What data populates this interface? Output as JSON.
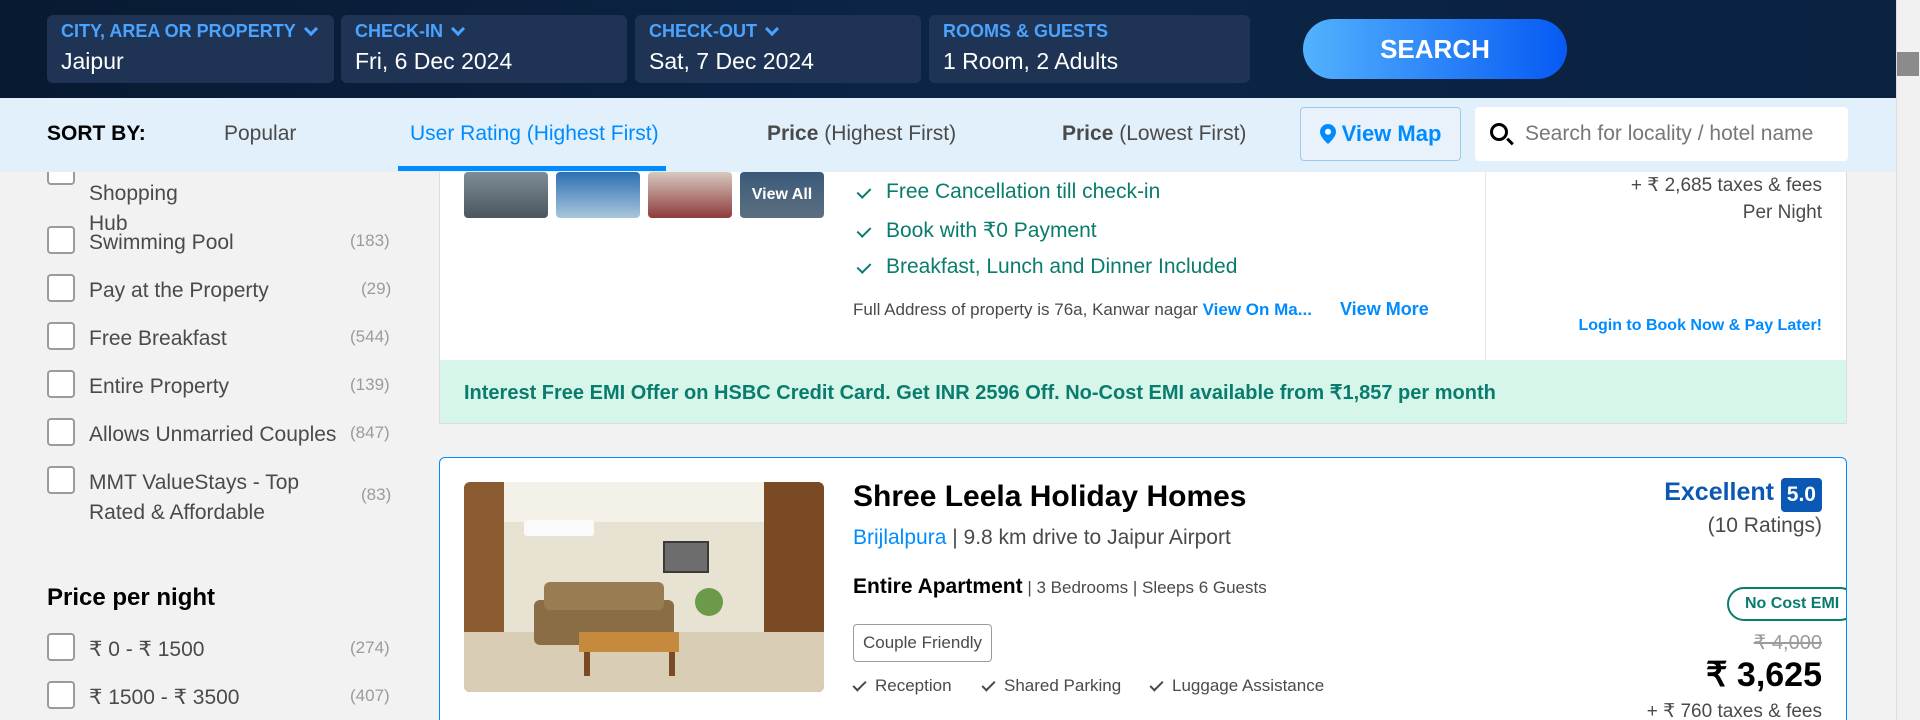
{
  "search": {
    "city_label": "CITY, AREA OR PROPERTY",
    "city_value": "Jaipur",
    "checkin_label": "CHECK-IN",
    "checkin_value": "Fri, 6 Dec 2024",
    "checkout_label": "CHECK-OUT",
    "checkout_value": "Sat, 7 Dec 2024",
    "rooms_label": "ROOMS & GUESTS",
    "rooms_value": "1 Room, 2 Adults",
    "button": "SEARCH"
  },
  "sort": {
    "label": "SORT BY:",
    "options": [
      {
        "main": "Popular",
        "sub": ""
      },
      {
        "main": "User Rating",
        "sub": "(Highest First)"
      },
      {
        "main": "Price",
        "sub": "(Highest First)"
      },
      {
        "main": "Price",
        "sub": "(Lowest First)"
      }
    ],
    "view_map": "View Map",
    "search_placeholder": "Search for locality / hotel name"
  },
  "filters": {
    "items": [
      {
        "label": "Shopping Hub",
        "count": ""
      },
      {
        "label": "Swimming Pool",
        "count": "(183)"
      },
      {
        "label": "Pay at the Property",
        "count": "(29)"
      },
      {
        "label": "Free Breakfast",
        "count": "(544)"
      },
      {
        "label": "Entire Property",
        "count": "(139)"
      },
      {
        "label": "Allows Unmarried Couples",
        "count": "(847)"
      },
      {
        "label": "MMT ValueStays - Top Rated & Affordable",
        "count": "(83)"
      }
    ],
    "price_heading": "Price per night",
    "price_items": [
      {
        "label": "₹ 0 - ₹ 1500",
        "count": "(274)"
      },
      {
        "label": "₹ 1500 - ₹ 3500",
        "count": "(407)"
      }
    ]
  },
  "card1": {
    "view_all": "View All",
    "features": [
      "Free Cancellation till check-in",
      "Book with ₹0 Payment",
      "Breakfast, Lunch and Dinner Included"
    ],
    "address": "Full Address of property is 76a, Kanwar nagar",
    "view_on_map": "View On Ma...",
    "view_more": "View More",
    "taxes": "+ ₹ 2,685 taxes & fees",
    "per_night": "Per Night",
    "login_link": "Login to Book Now & Pay Later!",
    "emi_banner": "Interest Free EMI Offer on HSBC Credit Card. Get INR 2596 Off. No-Cost EMI available from ₹1,857 per month"
  },
  "card2": {
    "name": "Shree Leela Holiday Homes",
    "locality": "Brijlalpura",
    "distance": "| 9.8 km drive to Jaipur Airport",
    "type": "Entire Apartment",
    "details": "| 3 Bedrooms | Sleeps 6 Guests",
    "tag": "Couple Friendly",
    "amenities": [
      "Reception",
      "Shared Parking",
      "Luggage Assistance"
    ],
    "rating_text": "Excellent",
    "rating_score": "5.0",
    "rating_count": "(10 Ratings)",
    "emi_chip": "No Cost EMI",
    "old_price": "₹ 4,000",
    "price": "₹ 3,625",
    "taxes": "+ ₹ 760 taxes & fees"
  },
  "colors": {
    "accent": "#008cff",
    "topbar": "#0c2547",
    "green": "#0a7c6d",
    "rating": "#0b58b4"
  }
}
